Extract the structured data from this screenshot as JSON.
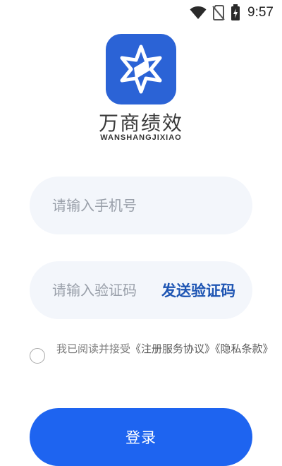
{
  "status_bar": {
    "time": "9:57",
    "icons": [
      "wifi-icon",
      "no-sim-icon",
      "battery-icon"
    ]
  },
  "brand": {
    "name": "万商绩效",
    "pinyin": "WANSHANGJIXIAO",
    "logo_color": "#2b63d6"
  },
  "form": {
    "phone_placeholder": "请输入手机号",
    "code_placeholder": "请输入验证码",
    "send_code_label": "发送验证码"
  },
  "agreement": {
    "prefix": "我已阅读并接受",
    "terms_link": "《注册服务协议》",
    "privacy_link": "《隐私条款》",
    "checked": false
  },
  "login_button": {
    "label": "登录",
    "color": "#1e64f0"
  }
}
